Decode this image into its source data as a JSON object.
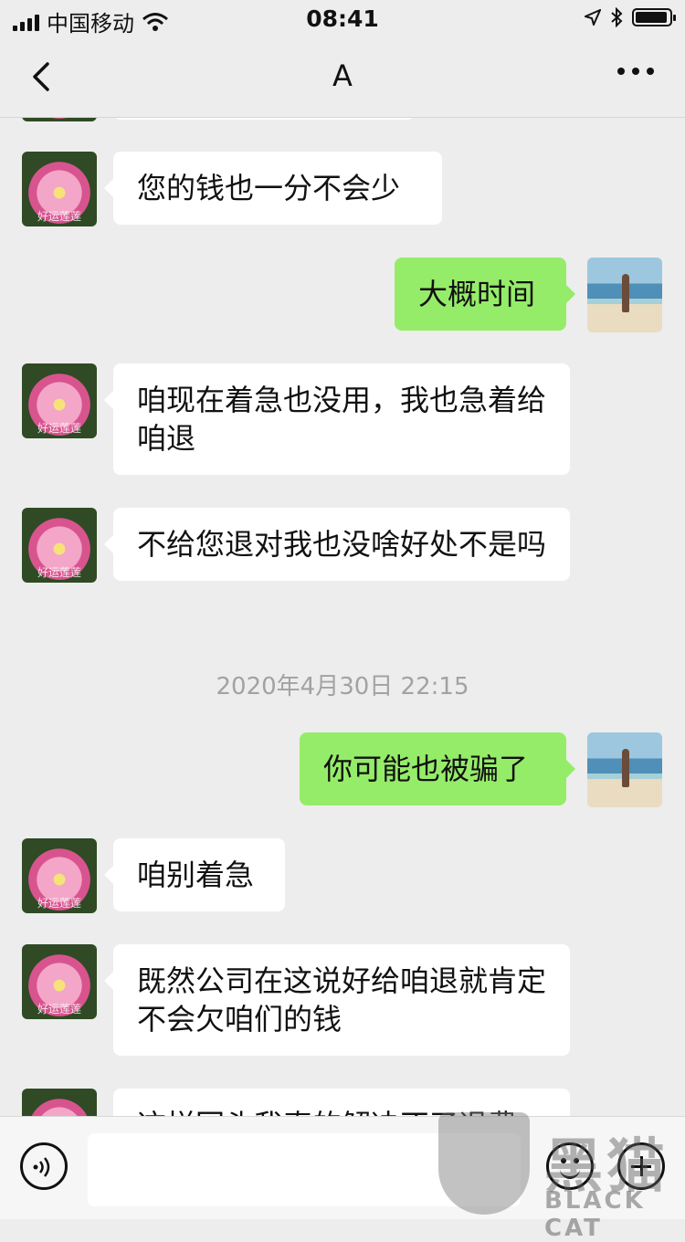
{
  "status_bar": {
    "carrier": "中国移动",
    "time": "08:41"
  },
  "nav": {
    "title": "A"
  },
  "messages": [
    {
      "side": "in",
      "text": "您的钱也一分不会少"
    },
    {
      "side": "out",
      "text": "大概时间"
    },
    {
      "side": "in",
      "text": "咱现在着急也没用，我也急着给咱退"
    },
    {
      "side": "in",
      "text": "不给您退对我也没啥好处不是吗"
    },
    {
      "timestamp": "2020年4月30日 22:15"
    },
    {
      "side": "out",
      "text": "你可能也被骗了"
    },
    {
      "side": "in",
      "text": "咱别着急"
    },
    {
      "side": "in",
      "text": "既然公司在这说好给咱退就肯定不会欠咱们的钱"
    },
    {
      "side": "in",
      "text": "这样回头我真的解决不了退费"
    }
  ],
  "avatar_caption": "好运莲莲",
  "watermark": {
    "cn": "黑猫",
    "en": "BLACK CAT"
  }
}
